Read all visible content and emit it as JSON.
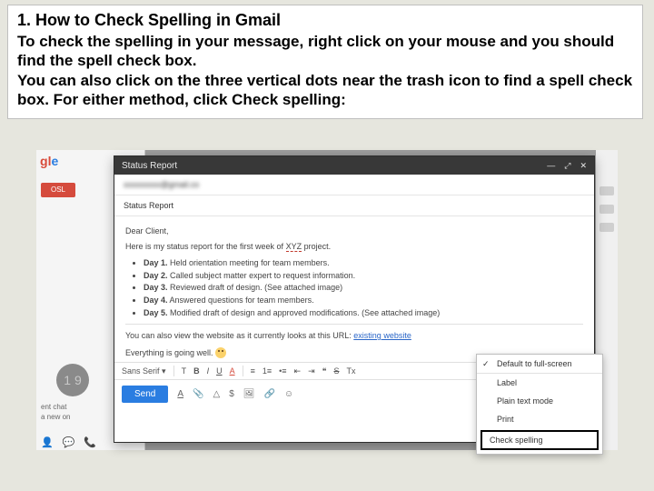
{
  "article": {
    "title": "1. How to Check Spelling in Gmail",
    "para1": "To check the spelling in your message, right click on your mouse and you should find the spell check box.",
    "para2": "You can also click on the three vertical dots near the trash icon to find a spell check box. For either method, click Check spelling:"
  },
  "gmail": {
    "logo_tail": "gle",
    "compose_button": "OSL",
    "avatar_text": "1 9",
    "recent_label": "ent chat",
    "new_label": "a new on",
    "bottom_icons": {
      "person": "person",
      "chat": "chat",
      "phone": "phone"
    }
  },
  "compose": {
    "title": "Status Report",
    "to_blur": "xxxxxxxxx@gmail.co",
    "subject": "Status Report",
    "salutation": "Dear Client,",
    "intro_a": "Here is my status report for the first week of ",
    "intro_xyz": "XYZ",
    "intro_b": " project.",
    "bullets": [
      {
        "day": "Day 1.",
        "text": " Held orientation meeting for team members."
      },
      {
        "day": "Day 2.",
        "text": " Called subject matter expert to request information."
      },
      {
        "day": "Day 3.",
        "text": " Reviewed draft of design. (See attached image)"
      },
      {
        "day": "Day 4.",
        "text": " Answered questions for team members."
      },
      {
        "day": "Day 5.",
        "text": " Modified draft of design and approved modifications. (See attached image)"
      }
    ],
    "website_a": "You can also view the website as it currently looks at this URL: ",
    "website_link": "existing website",
    "closing": "Everything is going well. ",
    "toolbar": {
      "font": "Sans Serif",
      "font_size": "T",
      "bold": "B",
      "italic": "I",
      "underline": "U",
      "textcolor": "A",
      "align": "≡",
      "list_num": "1≡",
      "list_bul": "•≡",
      "indent_out": "⇤",
      "indent_in": "⇥",
      "quote": "❝",
      "strike": "S",
      "clear": "Tx"
    },
    "sendbar": {
      "send": "Send",
      "format": "A",
      "attach": "📎",
      "drive": "△",
      "money": "$",
      "image": "🖼",
      "link": "🔗",
      "emoji": "☺"
    }
  },
  "context_menu": {
    "default_fullscreen": "Default to full-screen",
    "label": "Label",
    "plain_text": "Plain text mode",
    "print": "Print",
    "check_spelling": "Check spelling"
  }
}
